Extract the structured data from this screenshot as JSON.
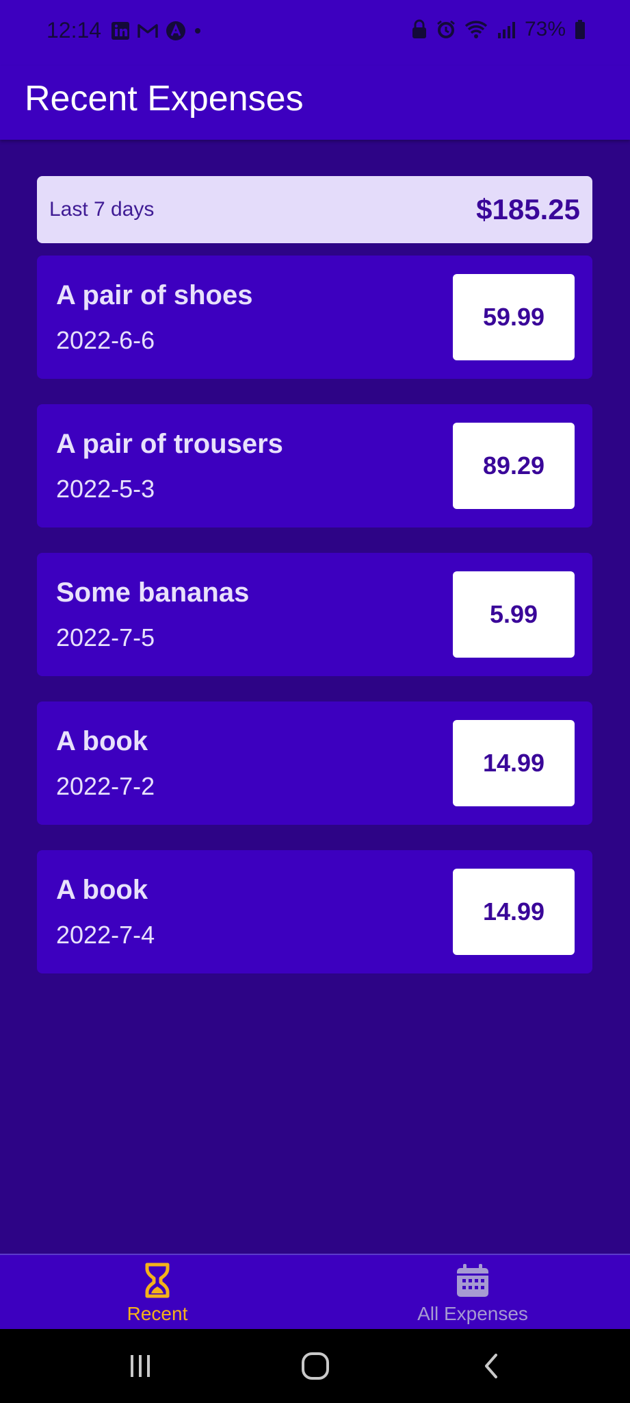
{
  "status_bar": {
    "time": "12:14",
    "battery": "73%"
  },
  "header": {
    "title": "Recent Expenses"
  },
  "summary": {
    "period": "Last 7 days",
    "sum": "$185.25"
  },
  "expenses": [
    {
      "description": "A pair of shoes",
      "date": "2022-6-6",
      "amount": "59.99"
    },
    {
      "description": "A pair of trousers",
      "date": "2022-5-3",
      "amount": "89.29"
    },
    {
      "description": "Some bananas",
      "date": "2022-7-5",
      "amount": "5.99"
    },
    {
      "description": "A book",
      "date": "2022-7-2",
      "amount": "14.99"
    },
    {
      "description": "A book",
      "date": "2022-7-4",
      "amount": "14.99"
    }
  ],
  "tabs": [
    {
      "label": "Recent",
      "icon": "hourglass-icon",
      "active": true
    },
    {
      "label": "All Expenses",
      "icon": "calendar-icon",
      "active": false
    }
  ],
  "colors": {
    "background": "#2d0486",
    "primary": "#3d00bf",
    "summary_bg": "#e4dcfa",
    "accent": "#f4b21a",
    "inactive_tab": "#a69ad2"
  }
}
